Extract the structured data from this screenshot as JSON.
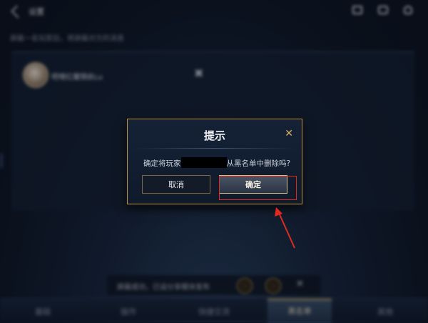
{
  "topbar": {
    "title": "设置",
    "icons": [
      "back-icon",
      "mail-icon",
      "chat-icon",
      "friend-icon"
    ]
  },
  "blacklist": {
    "hint": "屏蔽一名玩家后，将屏蔽对方的消息",
    "player_name": "吧嗖红魔锦纨Lu",
    "remove_icon": "✖"
  },
  "toast": {
    "text": "屏蔽成功，已设分享模块发布"
  },
  "tabs": [
    {
      "label": "基础"
    },
    {
      "label": "操作"
    },
    {
      "label": "快捷交流"
    },
    {
      "label": "黑名单"
    },
    {
      "label": "其他"
    }
  ],
  "active_tab": "黑名单",
  "modal": {
    "title": "提示",
    "close": "✕",
    "message_prefix": "确定将玩家",
    "message_suffix": "从黑名单中删除吗?",
    "cancel_label": "取消",
    "confirm_label": "确定"
  },
  "colors": {
    "accent_gold": "#b08d4f",
    "highlight_red": "#e02a1f"
  }
}
